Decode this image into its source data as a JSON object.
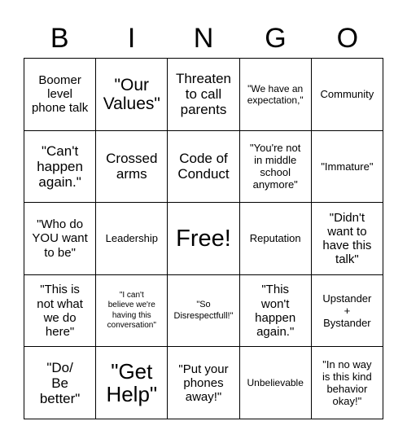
{
  "card": {
    "title": "BINGO",
    "header_letters": [
      "B",
      "I",
      "N",
      "G",
      "O"
    ],
    "free_space_index": 12,
    "colors": {
      "background": "#ffffff",
      "border": "#000000",
      "text": "#000000"
    },
    "cells": [
      {
        "text": "Boomer\nlevel\nphone talk",
        "size": "lg"
      },
      {
        "text": "\"Our\nValues\"",
        "size": "2xl"
      },
      {
        "text": "Threaten\nto call\nparents",
        "size": "xl"
      },
      {
        "text": "\"We have an\nexpectation,\"",
        "size": "sm"
      },
      {
        "text": "Community",
        "size": "md"
      },
      {
        "text": "\"Can't\nhappen\nagain.\"",
        "size": "xl"
      },
      {
        "text": "Crossed\narms",
        "size": "xl"
      },
      {
        "text": "Code of\nConduct",
        "size": "xl"
      },
      {
        "text": "\"You're not\nin middle\nschool\nanymore\"",
        "size": "md"
      },
      {
        "text": "\"Immature\"",
        "size": "md"
      },
      {
        "text": "\"Who do\nYOU want\nto be\"",
        "size": "lg"
      },
      {
        "text": "Leadership",
        "size": "md"
      },
      {
        "text": "Free!",
        "size": "4xl"
      },
      {
        "text": "Reputation",
        "size": "md"
      },
      {
        "text": "\"Didn't\nwant to\nhave this\ntalk\"",
        "size": "lg"
      },
      {
        "text": "\"This is\nnot what\nwe do\nhere\"",
        "size": "lg"
      },
      {
        "text": "\"I can't\nbelieve we're\nhaving this\nconversation\"",
        "size": "xxs"
      },
      {
        "text": "\"So\nDisrespectfull!\"",
        "size": "xs"
      },
      {
        "text": "\"This\nwon't\nhappen\nagain.\"",
        "size": "lg"
      },
      {
        "text": "Upstander\n+\nBystander",
        "size": "md"
      },
      {
        "text": "\"Do/\nBe\nbetter\"",
        "size": "xl"
      },
      {
        "text": "\"Get\nHelp\"",
        "size": "3xl"
      },
      {
        "text": "\"Put your\nphones\naway!\"",
        "size": "lg"
      },
      {
        "text": "Unbelievable",
        "size": "sm"
      },
      {
        "text": "\"In no way\nis this kind\nbehavior\nokay!\"",
        "size": "md"
      }
    ]
  }
}
